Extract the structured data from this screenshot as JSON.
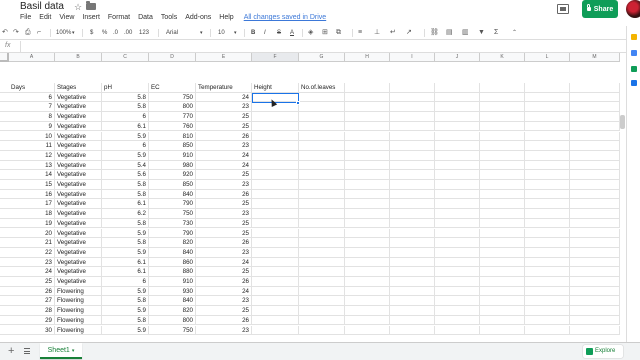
{
  "app": {
    "doc_title": "Basil data",
    "menu": [
      "File",
      "Edit",
      "View",
      "Insert",
      "Format",
      "Data",
      "Tools",
      "Add-ons",
      "Help"
    ],
    "save_status": "All changes saved in Drive",
    "share_label": "Share"
  },
  "toolbar": {
    "zoom": "100%",
    "currency": "$",
    "percent": "%",
    "dec_less": ".0",
    "dec_more": ".00",
    "more_formats": "123",
    "font": "Arial",
    "font_size": "10",
    "bold": "B",
    "italic": "I",
    "strike": "S",
    "text_color": "A"
  },
  "formula_bar": {
    "fx": "fx",
    "value": ""
  },
  "grid": {
    "columns": [
      "A",
      "B",
      "C",
      "D",
      "E",
      "F",
      "G",
      "H",
      "I",
      "J",
      "K",
      "L",
      "M"
    ],
    "selected_column": "F",
    "headers": [
      "Days",
      "Stages",
      "pH",
      "EC",
      "Temperature",
      "Height",
      "No.of.leaves"
    ],
    "rows": [
      {
        "days": "6",
        "stage": "Vegetative",
        "ph": "5.8",
        "ec": "750",
        "temp": "24"
      },
      {
        "days": "7",
        "stage": "Vegetative",
        "ph": "5.8",
        "ec": "800",
        "temp": "23"
      },
      {
        "days": "8",
        "stage": "Vegetative",
        "ph": "6",
        "ec": "770",
        "temp": "25"
      },
      {
        "days": "9",
        "stage": "Vegetative",
        "ph": "6.1",
        "ec": "760",
        "temp": "25"
      },
      {
        "days": "10",
        "stage": "Vegetative",
        "ph": "5.9",
        "ec": "810",
        "temp": "26"
      },
      {
        "days": "11",
        "stage": "Vegetative",
        "ph": "6",
        "ec": "850",
        "temp": "23"
      },
      {
        "days": "12",
        "stage": "Vegetative",
        "ph": "5.9",
        "ec": "910",
        "temp": "24"
      },
      {
        "days": "13",
        "stage": "Vegetative",
        "ph": "5.4",
        "ec": "980",
        "temp": "24"
      },
      {
        "days": "14",
        "stage": "Vegetative",
        "ph": "5.6",
        "ec": "920",
        "temp": "25"
      },
      {
        "days": "15",
        "stage": "Vegetative",
        "ph": "5.8",
        "ec": "850",
        "temp": "23"
      },
      {
        "days": "16",
        "stage": "Vegetative",
        "ph": "5.8",
        "ec": "840",
        "temp": "26"
      },
      {
        "days": "17",
        "stage": "Vegetative",
        "ph": "6.1",
        "ec": "790",
        "temp": "25"
      },
      {
        "days": "18",
        "stage": "Vegetative",
        "ph": "6.2",
        "ec": "750",
        "temp": "23"
      },
      {
        "days": "19",
        "stage": "Vegetative",
        "ph": "5.8",
        "ec": "730",
        "temp": "25"
      },
      {
        "days": "20",
        "stage": "Vegetative",
        "ph": "5.9",
        "ec": "790",
        "temp": "25"
      },
      {
        "days": "21",
        "stage": "Vegetative",
        "ph": "5.8",
        "ec": "820",
        "temp": "26"
      },
      {
        "days": "22",
        "stage": "Vegetative",
        "ph": "5.9",
        "ec": "840",
        "temp": "23"
      },
      {
        "days": "23",
        "stage": "Vegetative",
        "ph": "6.1",
        "ec": "860",
        "temp": "24"
      },
      {
        "days": "24",
        "stage": "Vegetative",
        "ph": "6.1",
        "ec": "880",
        "temp": "25"
      },
      {
        "days": "25",
        "stage": "Vegetative",
        "ph": "6",
        "ec": "910",
        "temp": "26"
      },
      {
        "days": "26",
        "stage": "Flowering",
        "ph": "5.9",
        "ec": "930",
        "temp": "24"
      },
      {
        "days": "27",
        "stage": "Flowering",
        "ph": "5.8",
        "ec": "840",
        "temp": "23"
      },
      {
        "days": "28",
        "stage": "Flowering",
        "ph": "5.9",
        "ec": "820",
        "temp": "25"
      },
      {
        "days": "29",
        "stage": "Flowering",
        "ph": "5.8",
        "ec": "800",
        "temp": "26"
      },
      {
        "days": "30",
        "stage": "Flowering",
        "ph": "5.9",
        "ec": "750",
        "temp": "23"
      }
    ]
  },
  "sheets": {
    "active": "Sheet1",
    "explore_label": "Explore"
  },
  "colors": {
    "accent": "#1a73e8",
    "share_green": "#0f9d58",
    "sheet_tab_green": "#188038",
    "save_link": "#3c78d8"
  }
}
